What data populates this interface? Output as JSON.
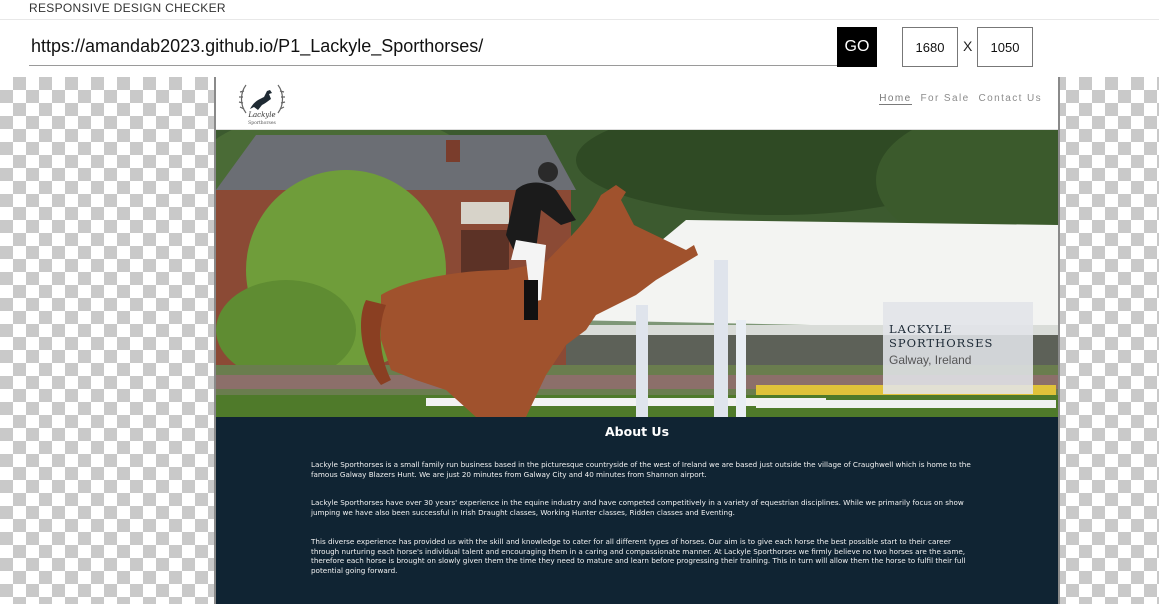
{
  "app": {
    "title": "RESPONSIVE DESIGN CHECKER"
  },
  "toolbar": {
    "url": "https://amandab2023.github.io/P1_Lackyle_Sporthorses/",
    "go_label": "GO",
    "width": "1680",
    "separator": "X",
    "height": "1050"
  },
  "site": {
    "logo": {
      "text": "Lackyle",
      "subtext": "Sporthorses",
      "icon": "horse-jumper-laurel-icon"
    },
    "nav": [
      {
        "label": "Home",
        "active": true
      },
      {
        "label": "For Sale",
        "active": false
      },
      {
        "label": "Contact Us",
        "active": false
      }
    ],
    "hero": {
      "name": "LACKYLE SPORTHORSES",
      "location": "Galway, Ireland"
    },
    "about": {
      "title": "About Us",
      "paragraphs": [
        "Lackyle Sporthorses is a small family run business based in the picturesque countryside of the west of Ireland we are based just outside the village of Craughwell which is home to the famous Galway Blazers Hunt. We are just 20 minutes from Galway City and 40 minutes from Shannon airport.",
        "Lackyle Sporthorses have over 30 years' experience in the equine industry and have competed competitively in a variety of equestrian disciplines. While we primarily focus on show jumping we have also been successful in Irish Draught classes, Working Hunter classes, Ridden classes and Eventing.",
        "This diverse experience has provided us with the skill and knowledge to cater for all different types of horses. Our aim is to give each horse the best possible start to their career through nurturing each horse's individual talent and encouraging them in a caring and compassionate manner. At Lackyle Sporthorses we firmly believe no two horses are the same, therefore each horse is brought on slowly given them the time they need to mature and learn before progressing their training. This in turn will allow them the horse to fulfil their full potential going forward."
      ]
    }
  }
}
